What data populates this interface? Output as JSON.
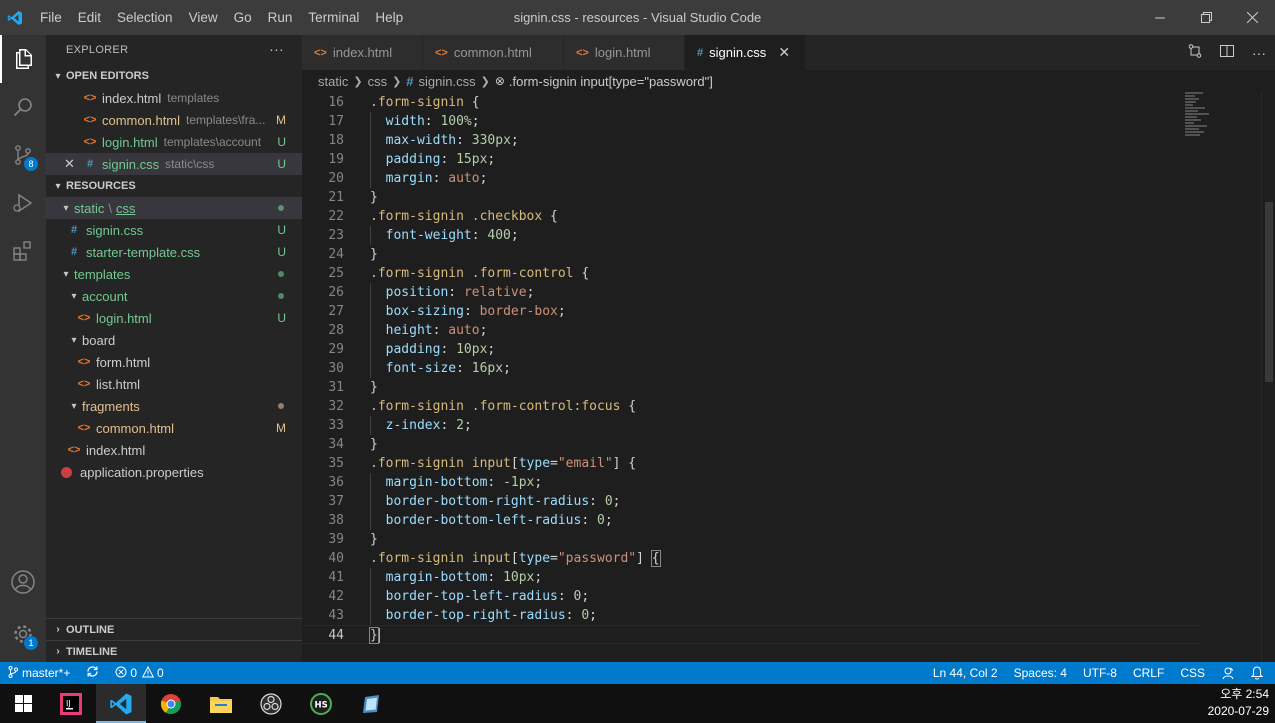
{
  "window": {
    "title": "signin.css - resources - Visual Studio Code",
    "menu": [
      "File",
      "Edit",
      "Selection",
      "View",
      "Go",
      "Run",
      "Terminal",
      "Help"
    ]
  },
  "activity_bar": {
    "scm_badge": "8",
    "settings_badge": "1"
  },
  "sidebar": {
    "header": "EXPLORER",
    "more": "···",
    "open_editors_title": "OPEN EDITORS",
    "open_editors": [
      {
        "name": "index.html",
        "desc": "templates",
        "deco": ""
      },
      {
        "name": "common.html",
        "desc": "templates\\fra...",
        "deco": "M"
      },
      {
        "name": "login.html",
        "desc": "templates\\account",
        "deco": "U"
      },
      {
        "name": "signin.css",
        "desc": "static\\css",
        "deco": "U"
      }
    ],
    "resources_title": "RESOURCES",
    "tree": {
      "static": "static",
      "static_sep": "\\",
      "css": "css",
      "signin": "signin.css",
      "signin_deco": "U",
      "starter": "starter-template.css",
      "starter_deco": "U",
      "templates": "templates",
      "account": "account",
      "login": "login.html",
      "login_deco": "U",
      "board": "board",
      "form": "form.html",
      "list": "list.html",
      "fragments": "fragments",
      "common": "common.html",
      "common_deco": "M",
      "index": "index.html",
      "props": "application.properties"
    },
    "outline_title": "OUTLINE",
    "timeline_title": "TIMELINE"
  },
  "tabs": [
    {
      "label": "index.html",
      "type": "html"
    },
    {
      "label": "common.html",
      "type": "html"
    },
    {
      "label": "login.html",
      "type": "html"
    },
    {
      "label": "signin.css",
      "type": "css"
    }
  ],
  "breadcrumb": {
    "seg1": "static",
    "seg2": "css",
    "seg3": "signin.css",
    "seg4": ".form-signin input[type=\"password\"]"
  },
  "editor": {
    "lines": [
      {
        "n": "16",
        "code": ".form-signin {"
      },
      {
        "n": "17",
        "code": "  width: 100%;"
      },
      {
        "n": "18",
        "code": "  max-width: 330px;"
      },
      {
        "n": "19",
        "code": "  padding: 15px;"
      },
      {
        "n": "20",
        "code": "  margin: auto;"
      },
      {
        "n": "21",
        "code": "}"
      },
      {
        "n": "22",
        "code": ".form-signin .checkbox {"
      },
      {
        "n": "23",
        "code": "  font-weight: 400;"
      },
      {
        "n": "24",
        "code": "}"
      },
      {
        "n": "25",
        "code": ".form-signin .form-control {"
      },
      {
        "n": "26",
        "code": "  position: relative;"
      },
      {
        "n": "27",
        "code": "  box-sizing: border-box;"
      },
      {
        "n": "28",
        "code": "  height: auto;"
      },
      {
        "n": "29",
        "code": "  padding: 10px;"
      },
      {
        "n": "30",
        "code": "  font-size: 16px;"
      },
      {
        "n": "31",
        "code": "}"
      },
      {
        "n": "32",
        "code": ".form-signin .form-control:focus {"
      },
      {
        "n": "33",
        "code": "  z-index: 2;"
      },
      {
        "n": "34",
        "code": "}"
      },
      {
        "n": "35",
        "code": ".form-signin input[type=\"email\"] {"
      },
      {
        "n": "36",
        "code": "  margin-bottom: -1px;"
      },
      {
        "n": "37",
        "code": "  border-bottom-right-radius: 0;"
      },
      {
        "n": "38",
        "code": "  border-bottom-left-radius: 0;"
      },
      {
        "n": "39",
        "code": "}"
      },
      {
        "n": "40",
        "code": ".form-signin input[type=\"password\"] {"
      },
      {
        "n": "41",
        "code": "  margin-bottom: 10px;"
      },
      {
        "n": "42",
        "code": "  border-top-left-radius: 0;"
      },
      {
        "n": "43",
        "code": "  border-top-right-radius: 0;"
      },
      {
        "n": "44",
        "code": "}"
      }
    ],
    "current_line": "44"
  },
  "statusbar": {
    "branch": "master*+",
    "errors": "0",
    "warnings": "0",
    "position": "Ln 44, Col 2",
    "spaces": "Spaces: 4",
    "encoding": "UTF-8",
    "eol": "CRLF",
    "language": "CSS"
  },
  "taskbar": {
    "time": "오후 2:54",
    "date": "2020-07-29"
  },
  "colors": {
    "accent": "#007acc",
    "modified": "#e2c08d",
    "untracked": "#73c991"
  }
}
